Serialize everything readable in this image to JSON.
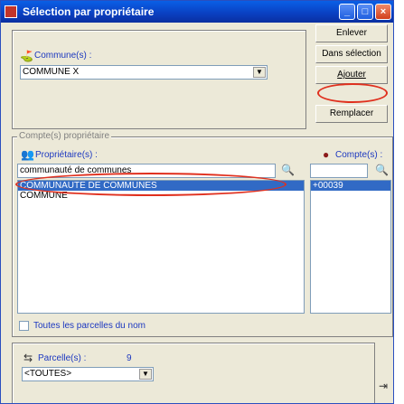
{
  "window": {
    "title": "Sélection par propriétaire"
  },
  "titlebar_buttons": {
    "minimize": "_",
    "maximize": "□",
    "close": "×"
  },
  "buttons": {
    "enlever": "Enlever",
    "dans_selection": "Dans sélection",
    "ajouter": "Ajouter",
    "remplacer": "Remplacer"
  },
  "commune": {
    "label": "Commune(s) :",
    "value": "COMMUNE X"
  },
  "compte_group": {
    "title": "Compte(s) propriétaire"
  },
  "proprietaire": {
    "label": "Propriétaire(s) :",
    "search_value": "communauté de communes",
    "items": [
      "COMMUNAUTE DE COMMUNES",
      "COMMUNE"
    ]
  },
  "compte": {
    "label": "Compte(s) :",
    "search_value": "",
    "items": [
      "+00039"
    ]
  },
  "toutes_parcelles": {
    "label": "Toutes les parcelles du nom"
  },
  "parcelle": {
    "label": "Parcelle(s) :",
    "count": "9",
    "value": "<TOUTES>"
  },
  "colors": {
    "selection": "#316ac5",
    "highlight_ring": "#e0301e",
    "title_bar": "#0a3fc0"
  }
}
